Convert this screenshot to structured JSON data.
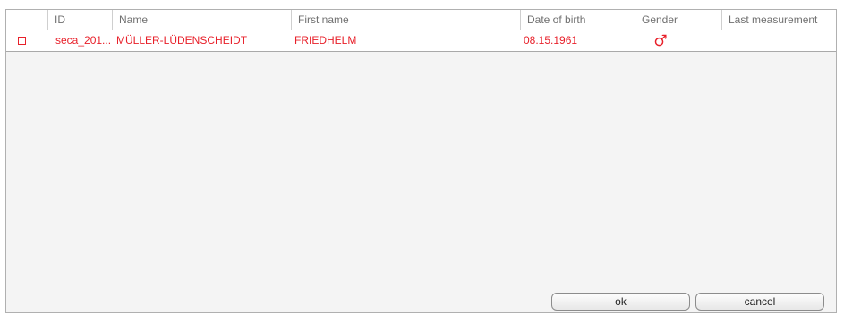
{
  "table": {
    "columns": [
      "ID",
      "Name",
      "First name",
      "Date of birth",
      "Gender",
      "Last measurement"
    ],
    "rows": [
      {
        "checked": false,
        "id": "seca_201...",
        "name": "MÜLLER-LÜDENSCHEIDT",
        "first_name": "FRIEDHELM",
        "date_of_birth": "08.15.1961",
        "gender": "male",
        "gender_symbol": "♂",
        "last_measurement": ""
      }
    ],
    "row_text_color": "#e8202a"
  },
  "buttons": {
    "ok": "ok",
    "cancel": "cancel"
  }
}
